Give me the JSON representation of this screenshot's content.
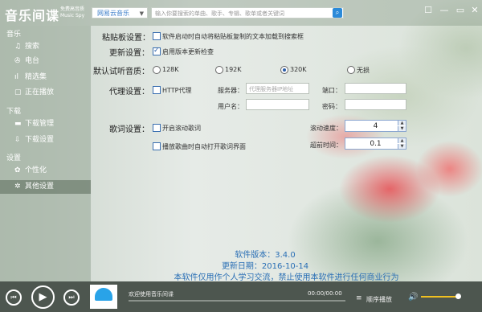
{
  "app": {
    "name": "音乐间谍",
    "sub1": "免费高音质",
    "sub2": "Music Spy"
  },
  "topbar": {
    "source": "网易云音乐",
    "search_placeholder": "输入你要搜索的单曲、歌手、专辑、歌单或者关键词"
  },
  "sidebar": {
    "sections": [
      {
        "title": "音乐",
        "items": [
          {
            "label": "搜索",
            "icon": "♫"
          },
          {
            "label": "电台",
            "icon": "✇"
          },
          {
            "label": "精选集",
            "icon": "ıl"
          },
          {
            "label": "正在播放",
            "icon": "▢"
          }
        ]
      },
      {
        "title": "下载",
        "items": [
          {
            "label": "下载管理",
            "icon": "▬"
          },
          {
            "label": "下载设置",
            "icon": "⇩"
          }
        ]
      },
      {
        "title": "设置",
        "items": [
          {
            "label": "个性化",
            "icon": "✿"
          },
          {
            "label": "其他设置",
            "icon": "✲"
          }
        ]
      }
    ]
  },
  "settings": {
    "clipboard": {
      "label": "粘贴板设置：",
      "option": "软件启动时自动将粘贴板复制的文本加载到搜索框",
      "checked": false
    },
    "update": {
      "label": "更新设置：",
      "option": "启用版本更新检查",
      "checked": true
    },
    "quality": {
      "label": "默认试听音质：",
      "options": [
        "128K",
        "192K",
        "320K",
        "无损"
      ],
      "selected": "320K"
    },
    "proxy": {
      "label": "代理设置：",
      "option": "HTTP代理",
      "checked": false,
      "server_label": "服务器：",
      "server_placeholder": "代理服务器IP地址",
      "port_label": "端口：",
      "user_label": "用户名：",
      "pass_label": "密码："
    },
    "lyrics": {
      "label": "歌词设置：",
      "scroll_option": "开启滚动歌词",
      "auto_open_option": "播放歌曲时自动打开歌词界面",
      "speed_label": "滚动速度：",
      "speed_value": "4",
      "advance_label": "超前时间：",
      "advance_value": "0.1"
    }
  },
  "about": {
    "version": "软件版本：3.4.0",
    "date": "更新日期：2016-10-14",
    "notice": "本软件仅用作个人学习交流，禁止使用本软件进行任何商业行为"
  },
  "player": {
    "now_playing": "欢迎使用音乐间谍",
    "time": "00:00/00:00",
    "mode": "顺序播放",
    "volume": 0.9
  }
}
